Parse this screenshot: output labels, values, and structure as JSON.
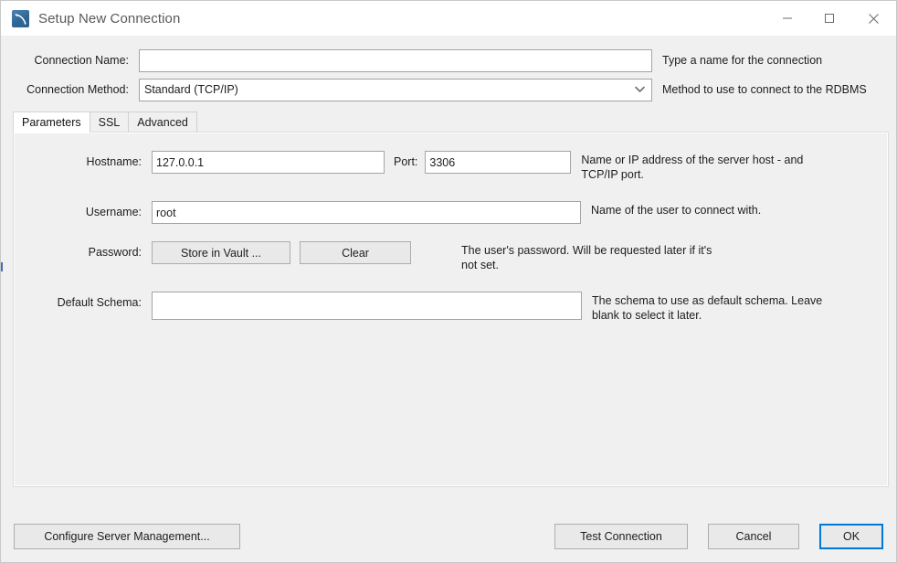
{
  "window": {
    "title": "Setup New Connection",
    "app_icon": "mysql-workbench-dolphin-icon",
    "controls": {
      "minimize": "minimize-icon",
      "maximize": "maximize-icon",
      "close": "close-icon"
    }
  },
  "form": {
    "connection_name": {
      "label": "Connection Name:",
      "value": "",
      "placeholder": "",
      "hint": "Type a name for the connection"
    },
    "connection_method": {
      "label": "Connection Method:",
      "value": "Standard (TCP/IP)",
      "hint": "Method to use to connect to the RDBMS",
      "options": [
        "Standard (TCP/IP)"
      ]
    }
  },
  "tabs": [
    {
      "label": "Parameters",
      "active": true
    },
    {
      "label": "SSL",
      "active": false
    },
    {
      "label": "Advanced",
      "active": false
    }
  ],
  "parameters": {
    "hostname": {
      "label": "Hostname:",
      "value": "127.0.0.1",
      "placeholder": ""
    },
    "port": {
      "label": "Port:",
      "value": "3306",
      "placeholder": ""
    },
    "host_port_hint": "Name or IP address of the server host - and\nTCP/IP port.",
    "username": {
      "label": "Username:",
      "value": "root",
      "placeholder": "",
      "hint": "Name of the user to connect with."
    },
    "password": {
      "label": "Password:",
      "store_button": "Store in Vault ...",
      "clear_button": "Clear",
      "hint": "The user's password. Will be requested later if it's\nnot set."
    },
    "default_schema": {
      "label": "Default Schema:",
      "value": "",
      "placeholder": "",
      "hint": "The schema to use as default schema. Leave\nblank to select it later."
    }
  },
  "footer": {
    "configure_server_management": "Configure Server Management...",
    "test_connection": "Test Connection",
    "cancel": "Cancel",
    "ok": "OK"
  },
  "colors": {
    "focus_blue": "#0078d7",
    "icon_blue": "#2f6694",
    "dialog_bg": "#f0f0f0",
    "field_bg": "#ffffff"
  }
}
